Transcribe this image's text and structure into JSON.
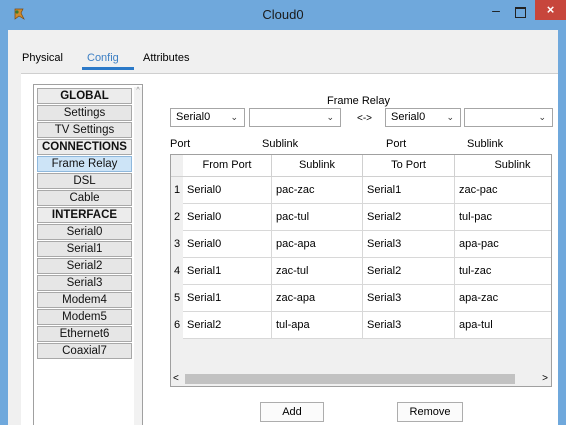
{
  "window": {
    "title": "Cloud0",
    "minimize_glyph": "–",
    "close_glyph": "×"
  },
  "tabs": [
    {
      "label": "Physical"
    },
    {
      "label": "Config"
    },
    {
      "label": "Attributes"
    }
  ],
  "nav": {
    "items": [
      {
        "label": "GLOBAL",
        "type": "head"
      },
      {
        "label": "Settings",
        "type": "item"
      },
      {
        "label": "TV Settings",
        "type": "item"
      },
      {
        "label": "CONNECTIONS",
        "type": "head"
      },
      {
        "label": "Frame Relay",
        "type": "active"
      },
      {
        "label": "DSL",
        "type": "item"
      },
      {
        "label": "Cable",
        "type": "item"
      },
      {
        "label": "INTERFACE",
        "type": "head"
      },
      {
        "label": "Serial0",
        "type": "item"
      },
      {
        "label": "Serial1",
        "type": "item"
      },
      {
        "label": "Serial2",
        "type": "item"
      },
      {
        "label": "Serial3",
        "type": "item"
      },
      {
        "label": "Modem4",
        "type": "item"
      },
      {
        "label": "Modem5",
        "type": "item"
      },
      {
        "label": "Ethernet6",
        "type": "item"
      },
      {
        "label": "Coaxial7",
        "type": "item"
      }
    ]
  },
  "frame_relay": {
    "title": "Frame Relay",
    "arrow": "<->",
    "port_a_value": "Serial0",
    "sublink_a_value": "",
    "port_b_value": "Serial0",
    "sublink_b_value": "",
    "labels": {
      "port": "Port",
      "sublink": "Sublink",
      "port2": "Port",
      "sublink2": "Sublink"
    }
  },
  "table": {
    "columns": [
      "From Port",
      "Sublink",
      "To Port",
      "Sublink"
    ],
    "rows": [
      {
        "n": "1",
        "from": "Serial0",
        "sub1": "pac-zac",
        "to": "Serial1",
        "sub2": "zac-pac"
      },
      {
        "n": "2",
        "from": "Serial0",
        "sub1": "pac-tul",
        "to": "Serial2",
        "sub2": "tul-pac"
      },
      {
        "n": "3",
        "from": "Serial0",
        "sub1": "pac-apa",
        "to": "Serial3",
        "sub2": "apa-pac"
      },
      {
        "n": "4",
        "from": "Serial1",
        "sub1": "zac-tul",
        "to": "Serial2",
        "sub2": "tul-zac"
      },
      {
        "n": "5",
        "from": "Serial1",
        "sub1": "zac-apa",
        "to": "Serial3",
        "sub2": "apa-zac"
      },
      {
        "n": "6",
        "from": "Serial2",
        "sub1": "tul-apa",
        "to": "Serial3",
        "sub2": "apa-tul"
      }
    ]
  },
  "buttons": {
    "add": "Add",
    "remove": "Remove"
  },
  "glyphs": {
    "chevron": "⌄",
    "scroll_left": "<",
    "scroll_right": ">",
    "scroll_up": "^"
  },
  "colors": {
    "titlebar": "#6fa8dc",
    "close": "#c7463c",
    "accent": "#2b79c8",
    "active_nav": "#cde4f7"
  }
}
